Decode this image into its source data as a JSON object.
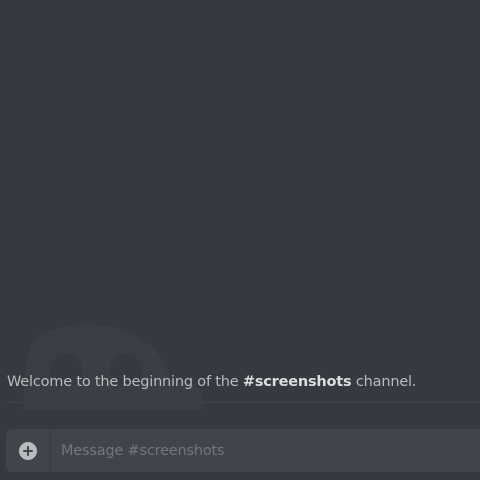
{
  "chat": {
    "welcome_prefix": "Welcome to the beginning of the ",
    "channel_name": "#screenshots",
    "welcome_suffix": " channel.",
    "watermark_icon": "discord-logo-icon"
  },
  "composer": {
    "placeholder": "Message #screenshots",
    "value": "",
    "upload_icon": "plus-circle-icon"
  },
  "colors": {
    "background": "#36393f",
    "input_background": "#40444b",
    "text_muted": "#b9bbbe",
    "text_bright": "#dcddde",
    "placeholder": "#72767d"
  }
}
